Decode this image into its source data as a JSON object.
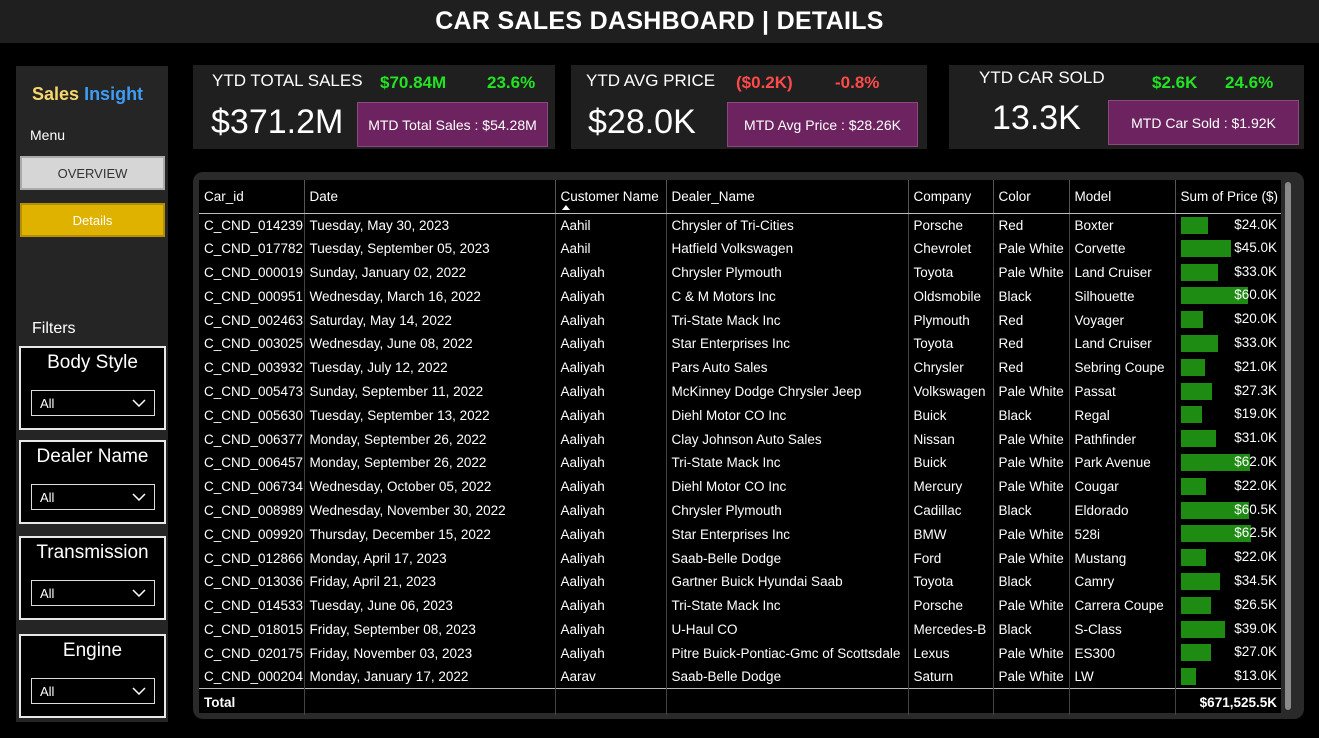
{
  "title": "CAR SALES DASHBOARD | DETAILS",
  "sidebar": {
    "brand_part1": "Sales",
    "brand_part2": "Insight",
    "menu_label": "Menu",
    "overview_label": "OVERVIEW",
    "details_label": "Details",
    "filters_label": "Filters",
    "filters": [
      {
        "title": "Body Style",
        "value": "All"
      },
      {
        "title": "Dealer Name",
        "value": "All"
      },
      {
        "title": "Transmission",
        "value": "All"
      },
      {
        "title": "Engine",
        "value": "All"
      }
    ]
  },
  "kpis": [
    {
      "title": "YTD TOTAL SALES",
      "value": "$371.2M",
      "delta1": "$70.84M",
      "delta2": "23.6%",
      "trend": "positive",
      "mtd": "MTD Total Sales : $54.28M"
    },
    {
      "title": "YTD AVG PRICE",
      "value": "$28.0K",
      "delta1": "($0.2K)",
      "delta2": "-0.8%",
      "trend": "negative",
      "mtd": "MTD Avg Price : $28.26K"
    },
    {
      "title": "YTD CAR SOLD",
      "value": "13.3K",
      "delta1": "$2.6K",
      "delta2": "24.6%",
      "trend": "positive",
      "mtd": "MTD Car Sold : $1.92K"
    }
  ],
  "colors": {
    "positive": "#22e322",
    "negative": "#ff4a4a",
    "bar": "#1e8b12",
    "mtd_bg": "#6d2360",
    "details_active": "#e0b200"
  },
  "table": {
    "columns": [
      "Car_id",
      "Date",
      "Customer Name",
      "Dealer_Name",
      "Company",
      "Color",
      "Model",
      "Sum of Price ($)"
    ],
    "sort_column": "Customer Name",
    "sort_direction": "ascending",
    "bar_max": 62.5,
    "rows": [
      {
        "car_id": "C_CND_014239",
        "date": "Tuesday, May 30, 2023",
        "customer": "Aahil",
        "dealer": "Chrysler of Tri-Cities",
        "company": "Porsche",
        "color": "Red",
        "model": "Boxter",
        "price": "$24.0K",
        "price_k": 24.0
      },
      {
        "car_id": "C_CND_017782",
        "date": "Tuesday, September 05, 2023",
        "customer": "Aahil",
        "dealer": "Hatfield Volkswagen",
        "company": "Chevrolet",
        "color": "Pale White",
        "model": "Corvette",
        "price": "$45.0K",
        "price_k": 45.0
      },
      {
        "car_id": "C_CND_000019",
        "date": "Sunday, January 02, 2022",
        "customer": "Aaliyah",
        "dealer": "Chrysler Plymouth",
        "company": "Toyota",
        "color": "Pale White",
        "model": "Land Cruiser",
        "price": "$33.0K",
        "price_k": 33.0
      },
      {
        "car_id": "C_CND_000951",
        "date": "Wednesday, March 16, 2022",
        "customer": "Aaliyah",
        "dealer": "C & M Motors Inc",
        "company": "Oldsmobile",
        "color": "Black",
        "model": "Silhouette",
        "price": "$60.0K",
        "price_k": 60.0
      },
      {
        "car_id": "C_CND_002463",
        "date": "Saturday, May 14, 2022",
        "customer": "Aaliyah",
        "dealer": "Tri-State Mack Inc",
        "company": "Plymouth",
        "color": "Red",
        "model": "Voyager",
        "price": "$20.0K",
        "price_k": 20.0
      },
      {
        "car_id": "C_CND_003025",
        "date": "Wednesday, June 08, 2022",
        "customer": "Aaliyah",
        "dealer": "Star Enterprises Inc",
        "company": "Toyota",
        "color": "Red",
        "model": "Land Cruiser",
        "price": "$33.0K",
        "price_k": 33.0
      },
      {
        "car_id": "C_CND_003932",
        "date": "Tuesday, July 12, 2022",
        "customer": "Aaliyah",
        "dealer": "Pars Auto Sales",
        "company": "Chrysler",
        "color": "Red",
        "model": "Sebring Coupe",
        "price": "$21.0K",
        "price_k": 21.0
      },
      {
        "car_id": "C_CND_005473",
        "date": "Sunday, September 11, 2022",
        "customer": "Aaliyah",
        "dealer": "McKinney Dodge Chrysler Jeep",
        "company": "Volkswagen",
        "color": "Pale White",
        "model": "Passat",
        "price": "$27.3K",
        "price_k": 27.3
      },
      {
        "car_id": "C_CND_005630",
        "date": "Tuesday, September 13, 2022",
        "customer": "Aaliyah",
        "dealer": "Diehl Motor CO Inc",
        "company": "Buick",
        "color": "Black",
        "model": "Regal",
        "price": "$19.0K",
        "price_k": 19.0
      },
      {
        "car_id": "C_CND_006377",
        "date": "Monday, September 26, 2022",
        "customer": "Aaliyah",
        "dealer": "Clay Johnson Auto Sales",
        "company": "Nissan",
        "color": "Pale White",
        "model": "Pathfinder",
        "price": "$31.0K",
        "price_k": 31.0
      },
      {
        "car_id": "C_CND_006457",
        "date": "Monday, September 26, 2022",
        "customer": "Aaliyah",
        "dealer": "Tri-State Mack Inc",
        "company": "Buick",
        "color": "Pale White",
        "model": "Park Avenue",
        "price": "$62.0K",
        "price_k": 62.0
      },
      {
        "car_id": "C_CND_006734",
        "date": "Wednesday, October 05, 2022",
        "customer": "Aaliyah",
        "dealer": "Diehl Motor CO Inc",
        "company": "Mercury",
        "color": "Pale White",
        "model": "Cougar",
        "price": "$22.0K",
        "price_k": 22.0
      },
      {
        "car_id": "C_CND_008989",
        "date": "Wednesday, November 30, 2022",
        "customer": "Aaliyah",
        "dealer": "Chrysler Plymouth",
        "company": "Cadillac",
        "color": "Black",
        "model": "Eldorado",
        "price": "$60.5K",
        "price_k": 60.5
      },
      {
        "car_id": "C_CND_009920",
        "date": "Thursday, December 15, 2022",
        "customer": "Aaliyah",
        "dealer": "Star Enterprises Inc",
        "company": "BMW",
        "color": "Pale White",
        "model": "528i",
        "price": "$62.5K",
        "price_k": 62.5
      },
      {
        "car_id": "C_CND_012866",
        "date": "Monday, April 17, 2023",
        "customer": "Aaliyah",
        "dealer": "Saab-Belle Dodge",
        "company": "Ford",
        "color": "Pale White",
        "model": "Mustang",
        "price": "$22.0K",
        "price_k": 22.0
      },
      {
        "car_id": "C_CND_013036",
        "date": "Friday, April 21, 2023",
        "customer": "Aaliyah",
        "dealer": "Gartner Buick Hyundai Saab",
        "company": "Toyota",
        "color": "Black",
        "model": "Camry",
        "price": "$34.5K",
        "price_k": 34.5
      },
      {
        "car_id": "C_CND_014533",
        "date": "Tuesday, June 06, 2023",
        "customer": "Aaliyah",
        "dealer": "Tri-State Mack Inc",
        "company": "Porsche",
        "color": "Pale White",
        "model": "Carrera Coupe",
        "price": "$26.5K",
        "price_k": 26.5
      },
      {
        "car_id": "C_CND_018015",
        "date": "Friday, September 08, 2023",
        "customer": "Aaliyah",
        "dealer": "U-Haul CO",
        "company": "Mercedes-B",
        "color": "Black",
        "model": "S-Class",
        "price": "$39.0K",
        "price_k": 39.0
      },
      {
        "car_id": "C_CND_020175",
        "date": "Friday, November 03, 2023",
        "customer": "Aaliyah",
        "dealer": "Pitre Buick-Pontiac-Gmc of Scottsdale",
        "company": "Lexus",
        "color": "Pale White",
        "model": "ES300",
        "price": "$27.0K",
        "price_k": 27.0
      },
      {
        "car_id": "C_CND_000204",
        "date": "Monday, January 17, 2022",
        "customer": "Aarav",
        "dealer": "Saab-Belle Dodge",
        "company": "Saturn",
        "color": "Pale White",
        "model": "LW",
        "price": "$13.0K",
        "price_k": 13.0
      }
    ],
    "total_label": "Total",
    "total_value": "$671,525.5K"
  }
}
